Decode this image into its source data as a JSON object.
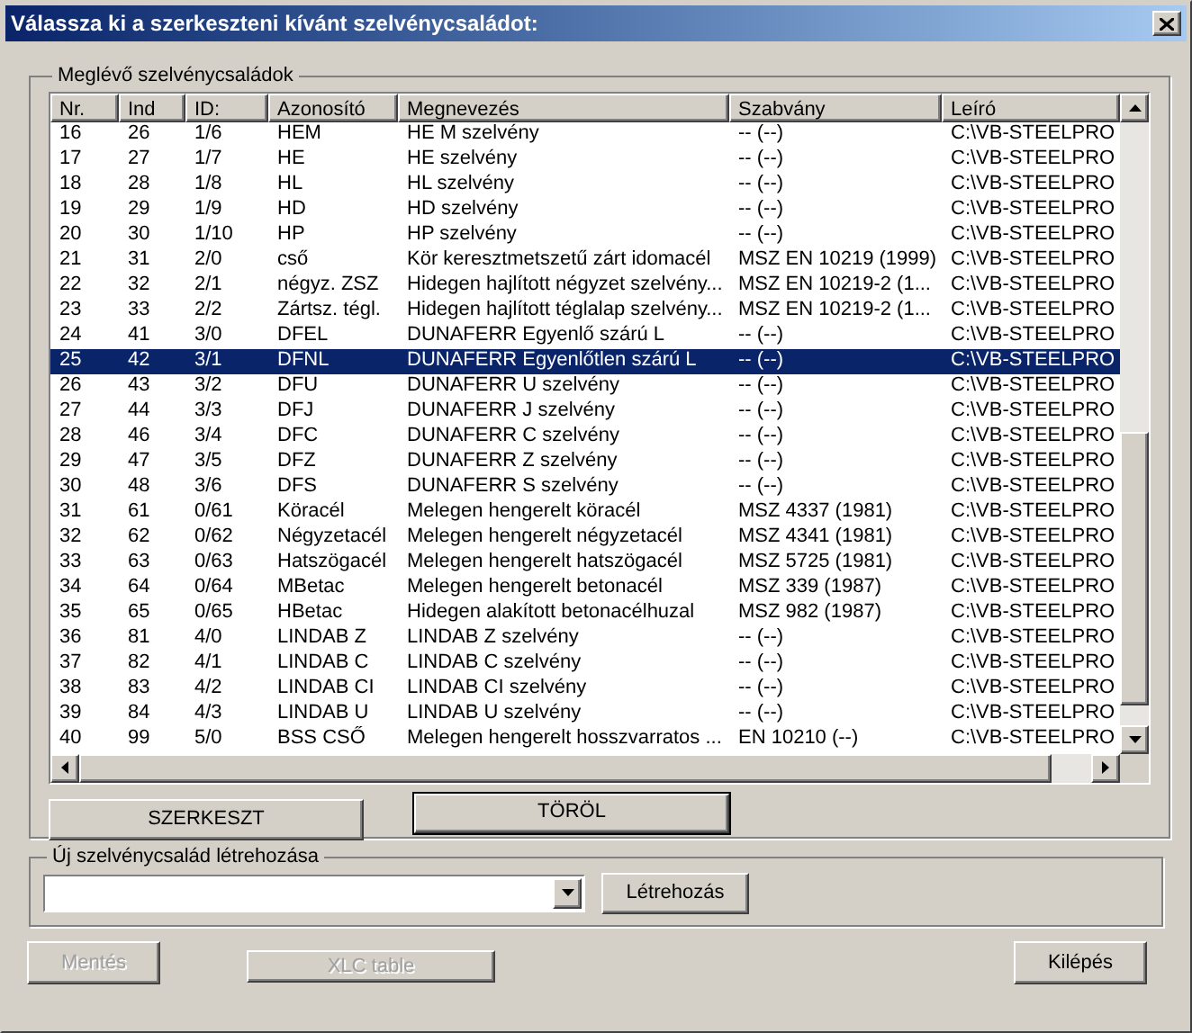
{
  "window": {
    "title": "Válassza ki a szerkeszteni kívánt szelvénycsaládot:"
  },
  "existing_group": {
    "title": "Meglévő szelvénycsaládok",
    "table": {
      "columns": [
        "Nr.",
        "Ind",
        "ID:",
        "Azonosító",
        "Megnevezés",
        "Szabvány",
        "Leíró"
      ],
      "rows": [
        {
          "cells": [
            "16",
            "26",
            "1/6",
            "HEM",
            "HE M szelvény",
            "-- (--)",
            "C:\\VB-STEELPRO"
          ],
          "selected": false
        },
        {
          "cells": [
            "17",
            "27",
            "1/7",
            "HE",
            "HE szelvény",
            "-- (--)",
            "C:\\VB-STEELPRO"
          ],
          "selected": false
        },
        {
          "cells": [
            "18",
            "28",
            "1/8",
            "HL",
            "HL szelvény",
            "-- (--)",
            "C:\\VB-STEELPRO"
          ],
          "selected": false
        },
        {
          "cells": [
            "19",
            "29",
            "1/9",
            "HD",
            "HD szelvény",
            "-- (--)",
            "C:\\VB-STEELPRO"
          ],
          "selected": false
        },
        {
          "cells": [
            "20",
            "30",
            "1/10",
            "HP",
            "HP szelvény",
            "-- (--)",
            "C:\\VB-STEELPRO"
          ],
          "selected": false
        },
        {
          "cells": [
            "21",
            "31",
            "2/0",
            "cső",
            "Kör keresztmetszetű zárt idomacél",
            "MSZ EN 10219 (1999)",
            "C:\\VB-STEELPRO"
          ],
          "selected": false
        },
        {
          "cells": [
            "22",
            "32",
            "2/1",
            "négyz. ZSZ",
            "Hidegen hajlított négyzet szelvény...",
            "MSZ EN 10219-2 (1...",
            "C:\\VB-STEELPRO"
          ],
          "selected": false
        },
        {
          "cells": [
            "23",
            "33",
            "2/2",
            "Zártsz. tégl.",
            "Hidegen hajlított téglalap szelvény...",
            "MSZ EN 10219-2 (1...",
            "C:\\VB-STEELPRO"
          ],
          "selected": false
        },
        {
          "cells": [
            "24",
            "41",
            "3/0",
            "DFEL",
            "DUNAFERR Egyenlő szárú L",
            "-- (--)",
            "C:\\VB-STEELPRO"
          ],
          "selected": false
        },
        {
          "cells": [
            "25",
            "42",
            "3/1",
            "DFNL",
            "DUNAFERR Egyenlőtlen szárú L",
            "-- (--)",
            "C:\\VB-STEELPRO"
          ],
          "selected": true
        },
        {
          "cells": [
            "26",
            "43",
            "3/2",
            "DFU",
            "DUNAFERR U szelvény",
            "-- (--)",
            "C:\\VB-STEELPRO"
          ],
          "selected": false
        },
        {
          "cells": [
            "27",
            "44",
            "3/3",
            "DFJ",
            "DUNAFERR J szelvény",
            "-- (--)",
            "C:\\VB-STEELPRO"
          ],
          "selected": false
        },
        {
          "cells": [
            "28",
            "46",
            "3/4",
            "DFC",
            "DUNAFERR C szelvény",
            "-- (--)",
            "C:\\VB-STEELPRO"
          ],
          "selected": false
        },
        {
          "cells": [
            "29",
            "47",
            "3/5",
            "DFZ",
            "DUNAFERR Z szelvény",
            "-- (--)",
            "C:\\VB-STEELPRO"
          ],
          "selected": false
        },
        {
          "cells": [
            "30",
            "48",
            "3/6",
            "DFS",
            "DUNAFERR S szelvény",
            "-- (--)",
            "C:\\VB-STEELPRO"
          ],
          "selected": false
        },
        {
          "cells": [
            "31",
            "61",
            "0/61",
            "Köracél",
            "Melegen hengerelt köracél",
            "MSZ 4337 (1981)",
            "C:\\VB-STEELPRO"
          ],
          "selected": false
        },
        {
          "cells": [
            "32",
            "62",
            "0/62",
            "Négyzetacél",
            "Melegen hengerelt négyzetacél",
            "MSZ 4341 (1981)",
            "C:\\VB-STEELPRO"
          ],
          "selected": false
        },
        {
          "cells": [
            "33",
            "63",
            "0/63",
            "Hatszögacél",
            "Melegen hengerelt hatszögacél",
            "MSZ 5725 (1981)",
            "C:\\VB-STEELPRO"
          ],
          "selected": false
        },
        {
          "cells": [
            "34",
            "64",
            "0/64",
            "MBetac",
            "Melegen hengerelt betonacél",
            "MSZ 339 (1987)",
            "C:\\VB-STEELPRO"
          ],
          "selected": false
        },
        {
          "cells": [
            "35",
            "65",
            "0/65",
            "HBetac",
            "Hidegen alakított betonacélhuzal",
            "MSZ 982 (1987)",
            "C:\\VB-STEELPRO"
          ],
          "selected": false
        },
        {
          "cells": [
            "36",
            "81",
            "4/0",
            "LINDAB Z",
            "LINDAB Z szelvény",
            "-- (--)",
            "C:\\VB-STEELPRO"
          ],
          "selected": false
        },
        {
          "cells": [
            "37",
            "82",
            "4/1",
            "LINDAB C",
            "LINDAB C szelvény",
            "-- (--)",
            "C:\\VB-STEELPRO"
          ],
          "selected": false
        },
        {
          "cells": [
            "38",
            "83",
            "4/2",
            "LINDAB CI",
            "LINDAB CI szelvény",
            "-- (--)",
            "C:\\VB-STEELPRO"
          ],
          "selected": false
        },
        {
          "cells": [
            "39",
            "84",
            "4/3",
            "LINDAB U",
            "LINDAB U szelvény",
            "-- (--)",
            "C:\\VB-STEELPRO"
          ],
          "selected": false
        },
        {
          "cells": [
            "40",
            "99",
            "5/0",
            "BSS CSŐ",
            "Melegen hengerelt hosszvarratos ...",
            "EN 10210 (--)",
            "C:\\VB-STEELPRO"
          ],
          "selected": false
        }
      ]
    },
    "buttons": [
      {
        "label": "SZERKESZT",
        "default": false
      },
      {
        "label": "TÖRÖL",
        "default": true
      }
    ]
  },
  "new_group": {
    "title": "Új szelvénycsalád létrehozása",
    "button": "Létrehozás"
  },
  "footer_buttons": [
    {
      "label": "Mentés",
      "disabled": true
    },
    {
      "label": "XLC table",
      "disabled": true
    },
    {
      "label": "Kilépés",
      "disabled": false
    }
  ]
}
